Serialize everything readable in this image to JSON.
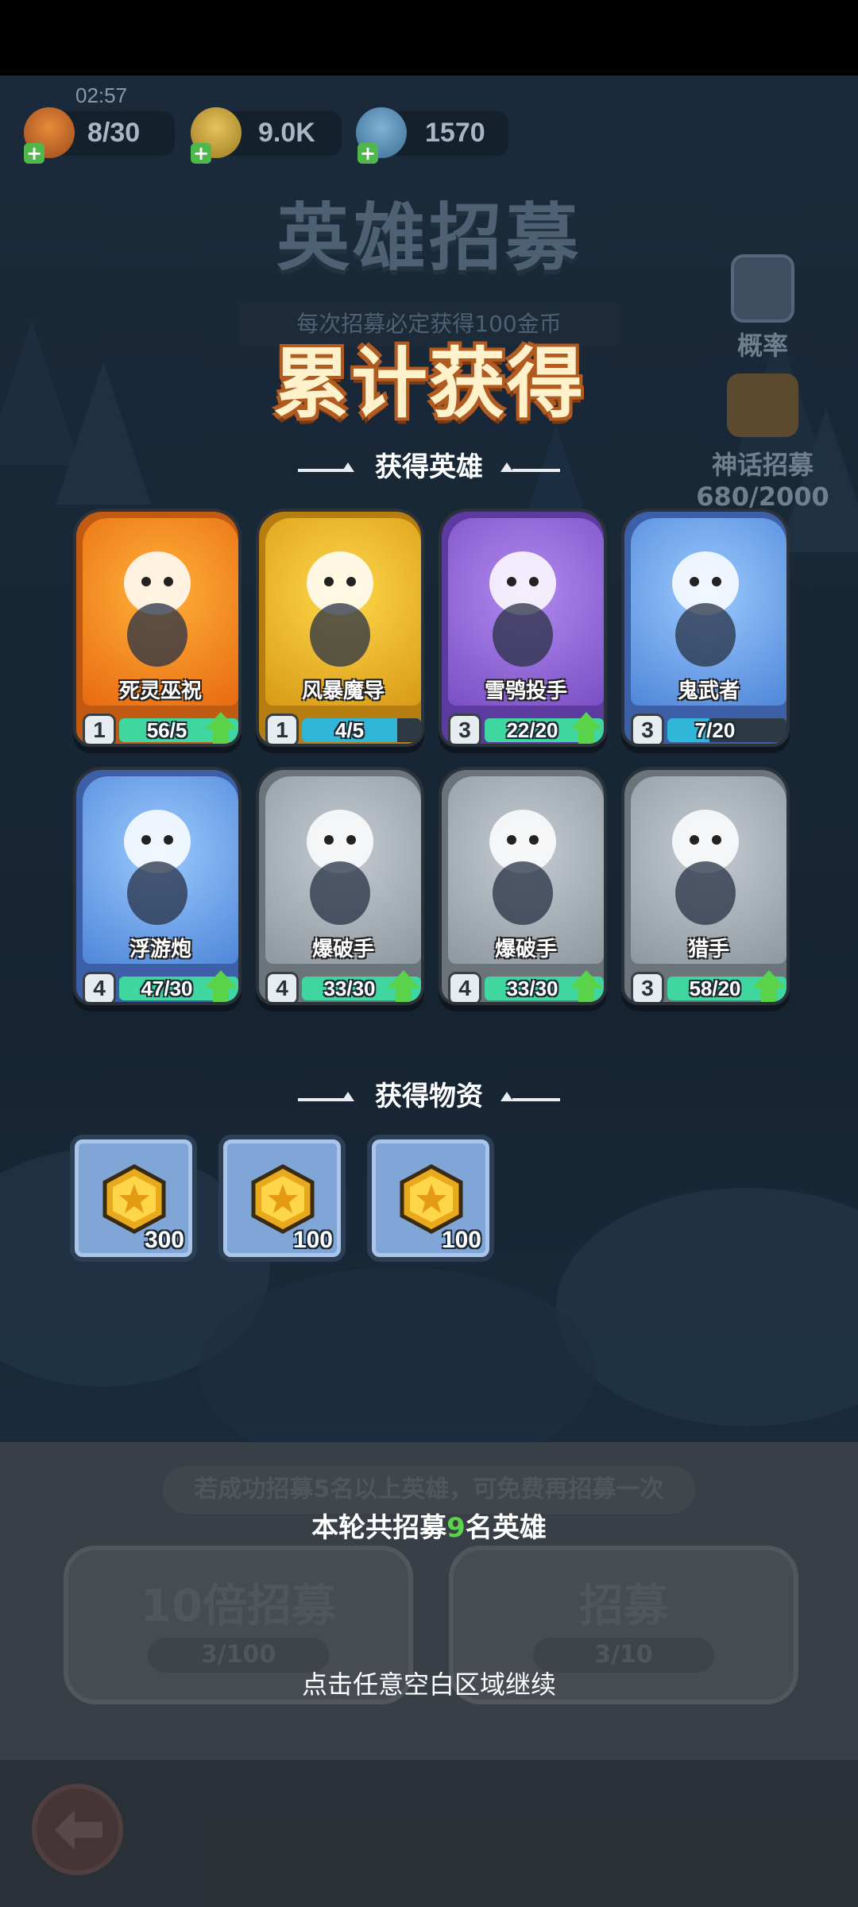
{
  "status": {
    "time": "02:57"
  },
  "resources": {
    "energy": "8/30",
    "gold": "9.0K",
    "gems": "1570"
  },
  "background": {
    "title": "英雄招募",
    "subtitle": "每次招募必定获得100金币",
    "probability_label": "概率",
    "mythic_label": "神话招募",
    "mythic_progress": "680/2000",
    "free_hint": "若成功招募5名以上英雄，可免费再招募一次",
    "ten_pull_label": "10倍招募",
    "ten_pull_count": "3/100",
    "single_pull_label": "招募",
    "single_pull_count": "3/10"
  },
  "main_title": "累计获得",
  "heroes_section_label": "获得英雄",
  "items_section_label": "获得物资",
  "heroes": [
    {
      "name": "死灵巫祝",
      "level": "1",
      "progress": "56/5",
      "upgradable": true,
      "rarity": "orange"
    },
    {
      "name": "风暴魔导",
      "level": "1",
      "progress": "4/5",
      "upgradable": false,
      "rarity": "gold"
    },
    {
      "name": "雪鸮投手",
      "level": "3",
      "progress": "22/20",
      "upgradable": true,
      "rarity": "purple"
    },
    {
      "name": "鬼武者",
      "level": "3",
      "progress": "7/20",
      "upgradable": false,
      "rarity": "blue"
    },
    {
      "name": "浮游炮",
      "level": "4",
      "progress": "47/30",
      "upgradable": true,
      "rarity": "blue"
    },
    {
      "name": "爆破手",
      "level": "4",
      "progress": "33/30",
      "upgradable": true,
      "rarity": "gray"
    },
    {
      "name": "爆破手",
      "level": "4",
      "progress": "33/30",
      "upgradable": true,
      "rarity": "gray"
    },
    {
      "name": "猎手",
      "level": "3",
      "progress": "58/20",
      "upgradable": true,
      "rarity": "gray"
    }
  ],
  "items": [
    {
      "icon": "gold-coin-icon",
      "quantity": "300"
    },
    {
      "icon": "gold-coin-icon",
      "quantity": "100"
    },
    {
      "icon": "gold-coin-icon",
      "quantity": "100"
    }
  ],
  "summary": {
    "prefix": "本轮共招募",
    "count": "9",
    "suffix": "名英雄"
  },
  "continue_hint": "点击任意空白区域继续",
  "colors": {
    "orange": "#f29a1f",
    "gold": "#f2c230",
    "purple": "#9a6fd8",
    "blue": "#6fa8ec",
    "gray": "#9aa2ab",
    "bar_fill": "#3fd6a0",
    "bar_partial": "#32b6d8",
    "green_accent": "#5ad34a"
  }
}
